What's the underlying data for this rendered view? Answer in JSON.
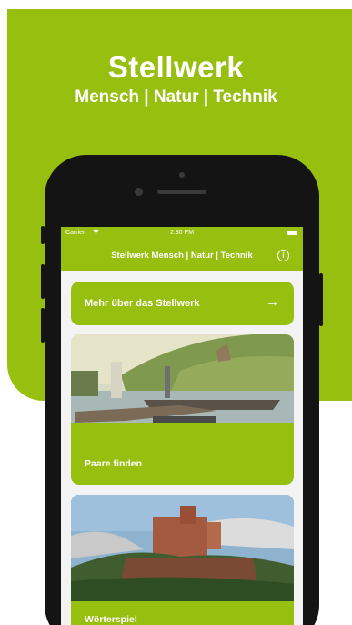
{
  "hero": {
    "title": "Stellwerk",
    "subtitle": "Mensch | Natur | Technik"
  },
  "status_bar": {
    "carrier": "Carrier",
    "time": "2:30 PM"
  },
  "nav": {
    "title": "Stellwerk Mensch | Natur | Technik",
    "info_icon": "info-icon"
  },
  "cards": [
    {
      "label": "Mehr über das Stellwerk",
      "icon": "arrow-right-icon"
    },
    {
      "label": "Paare finden",
      "image": "river-ferry-photo"
    },
    {
      "label": "Wörterspiel",
      "image": "castle-photo"
    }
  ],
  "colors": {
    "brand_green": "#97bf0f",
    "phone_frame": "#141414"
  }
}
